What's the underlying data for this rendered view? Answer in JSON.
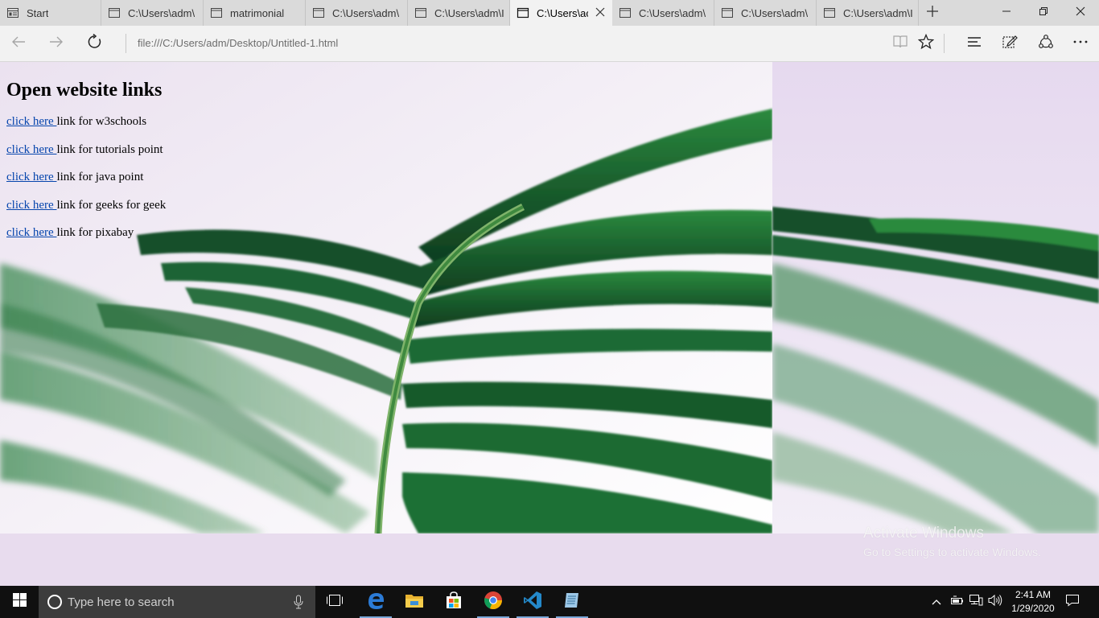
{
  "browser": {
    "tabs": [
      {
        "label": "Start",
        "icon": "start-page-icon"
      },
      {
        "label": "C:\\Users\\adm\\",
        "icon": "page-icon"
      },
      {
        "label": "matrimonial",
        "icon": "page-icon"
      },
      {
        "label": "C:\\Users\\adm\\",
        "icon": "page-icon"
      },
      {
        "label": "C:\\Users\\adm\\I",
        "icon": "page-icon"
      },
      {
        "label": "C:\\Users\\ac",
        "icon": "page-icon",
        "active": true
      },
      {
        "label": "C:\\Users\\adm\\",
        "icon": "page-icon"
      },
      {
        "label": "C:\\Users\\adm\\",
        "icon": "page-icon"
      },
      {
        "label": "C:\\Users\\adm\\I",
        "icon": "page-icon"
      }
    ],
    "address": "file:///C:/Users/adm/Desktop/Untitled-1.html"
  },
  "page": {
    "heading": "Open website links",
    "links": [
      {
        "link_text": "click here ",
        "suffix": "link for w3schools"
      },
      {
        "link_text": "click here ",
        "suffix": "link for tutorials point"
      },
      {
        "link_text": "click here ",
        "suffix": "link for java point"
      },
      {
        "link_text": "click here ",
        "suffix": "link for geeks for geek"
      },
      {
        "link_text": "click here ",
        "suffix": "link for pixabay"
      }
    ],
    "watermark": {
      "title": "Activate Windows",
      "subtitle": "Go to Settings to activate Windows."
    }
  },
  "taskbar": {
    "search_placeholder": "Type here to search",
    "time": "2:41 AM",
    "date": "1/29/2020",
    "pinned": [
      "task-view-icon",
      "edge-icon",
      "file-explorer-icon",
      "store-icon",
      "chrome-icon",
      "vscode-icon",
      "notepad-icon"
    ]
  },
  "colors": {
    "link": "#0645ad",
    "page_background": "#e8dcee",
    "taskbar": "#101010",
    "leaf_green": "#1f6b33"
  }
}
